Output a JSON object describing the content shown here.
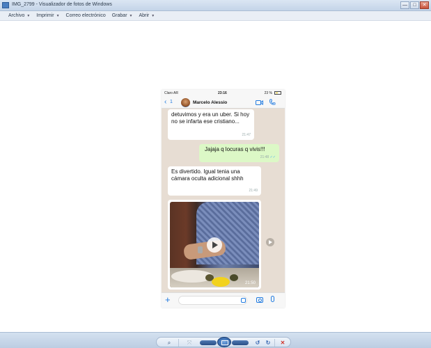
{
  "window": {
    "title": "IMG_2799 - Visualizador de fotos de Windows",
    "controls": {
      "minimize": "—",
      "maximize": "□",
      "close": "✕"
    }
  },
  "menu": {
    "items": [
      {
        "label": "Archivo"
      },
      {
        "label": "Imprimir"
      },
      {
        "label": "Correo electrónico"
      },
      {
        "label": "Grabar"
      },
      {
        "label": "Abrir"
      }
    ]
  },
  "phone": {
    "status": {
      "carrier": "Claro AR",
      "time": "23:16",
      "battery": "23 %"
    },
    "header": {
      "back_count": "1",
      "contact_name": "Marcelo Alessio"
    },
    "messages": [
      {
        "direction": "in",
        "text": "detuvimos y era un uber. Si hoy no se infarta ese cristiano...",
        "time": "21:47"
      },
      {
        "direction": "out",
        "text": "Jajaja q locuras q vivis!!!",
        "time": "21:48",
        "ticks": "✓✓"
      },
      {
        "direction": "in",
        "text": "Es divertido. Igual tenia una cámara oculta adicional shhh",
        "time": "21:49"
      }
    ],
    "media": {
      "time": "21:50"
    },
    "composer": {
      "plus": "+"
    }
  },
  "toolbar": {
    "zoom": "⌕",
    "fit": "⤧",
    "rotate_left": "↺",
    "rotate_right": "↻",
    "delete": "✕"
  },
  "colors": {
    "accent": "#1f7ae0",
    "outgoing_bubble": "#dcf8c6",
    "chat_background": "#e7ddd3",
    "delete": "#d0342c"
  }
}
